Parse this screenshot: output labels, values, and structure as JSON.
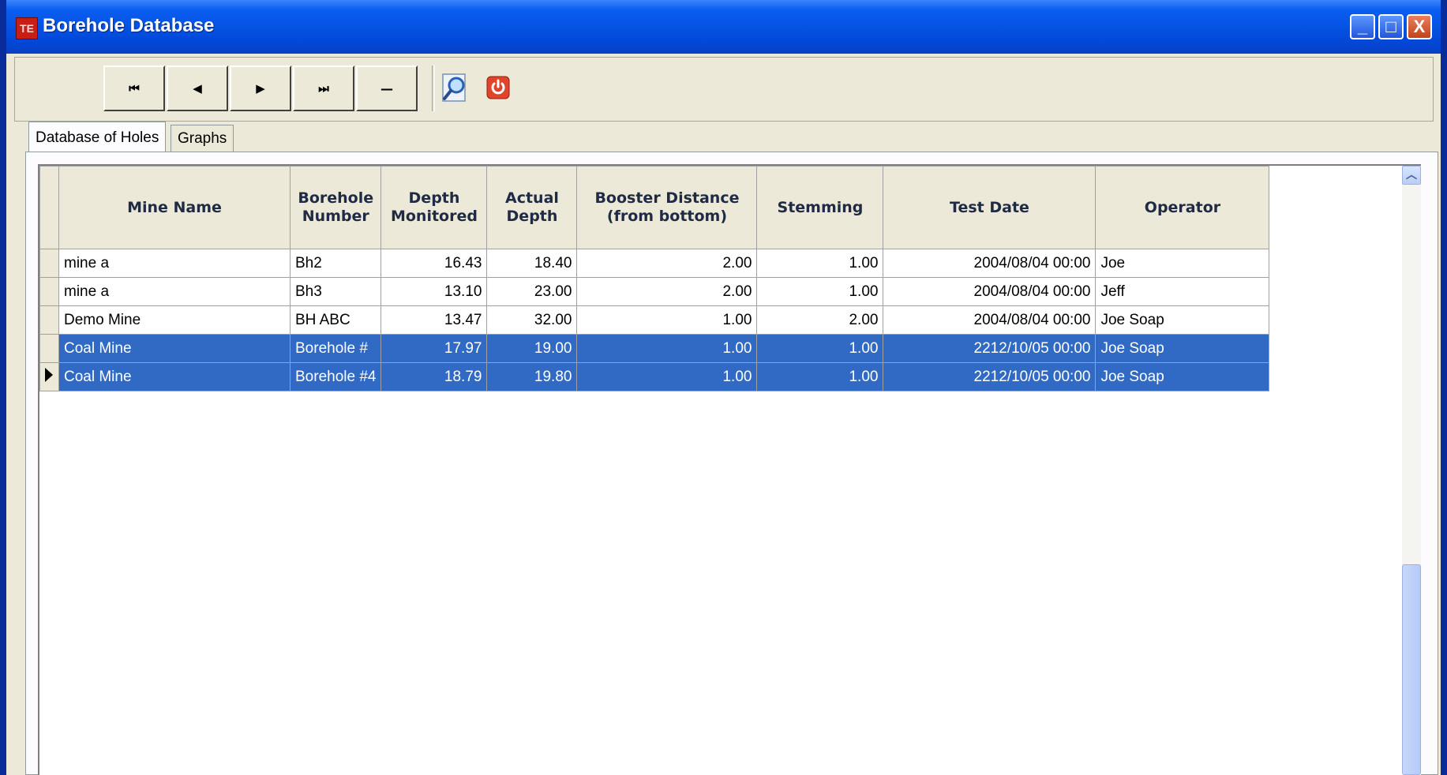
{
  "window": {
    "title": "Borehole Database",
    "app_icon": "app-logo-icon",
    "controls": {
      "minimize": "_",
      "maximize": "□",
      "close": "X"
    }
  },
  "toolbar": {
    "first": "⏮",
    "prev": "◀",
    "next": "▶",
    "last": "⏭",
    "delete": "—",
    "search_icon": "magnifier-icon",
    "exit_icon": "power-icon"
  },
  "tabs": [
    {
      "label": "Database of Holes",
      "active": true
    },
    {
      "label": "Graphs",
      "active": false
    }
  ],
  "grid": {
    "columns": [
      "Mine Name",
      "Borehole Number",
      "Depth Monitored",
      "Actual Depth",
      "Booster Distance (from bottom)",
      "Stemming",
      "Test Date",
      "Operator"
    ],
    "rows": [
      {
        "mine": "mine a",
        "borehole": "Bh2",
        "depth_monitored": "16.43",
        "actual_depth": "18.40",
        "booster": "2.00",
        "stemming": "1.00",
        "test_date": "2004/08/04 00:00",
        "operator": "Joe",
        "selected": false,
        "current": false
      },
      {
        "mine": "mine a",
        "borehole": "Bh3",
        "depth_monitored": "13.10",
        "actual_depth": "23.00",
        "booster": "2.00",
        "stemming": "1.00",
        "test_date": "2004/08/04 00:00",
        "operator": "Jeff",
        "selected": false,
        "current": false
      },
      {
        "mine": "Demo Mine",
        "borehole": "BH ABC",
        "depth_monitored": "13.47",
        "actual_depth": "32.00",
        "booster": "1.00",
        "stemming": "2.00",
        "test_date": "2004/08/04 00:00",
        "operator": "Joe Soap",
        "selected": false,
        "current": false
      },
      {
        "mine": "Coal Mine",
        "borehole": "Borehole #",
        "depth_monitored": "17.97",
        "actual_depth": "19.00",
        "booster": "1.00",
        "stemming": "1.00",
        "test_date": "2212/10/05 00:00",
        "operator": "Joe Soap",
        "selected": true,
        "current": false
      },
      {
        "mine": "Coal Mine",
        "borehole": "Borehole #4",
        "depth_monitored": "18.79",
        "actual_depth": "19.80",
        "booster": "1.00",
        "stemming": "1.00",
        "test_date": "2212/10/05 00:00",
        "operator": "Joe Soap",
        "selected": true,
        "current": true
      }
    ]
  },
  "colors": {
    "selection": "#316ac5",
    "titlebar": "#0552e3",
    "desktop": "#8b0000"
  }
}
